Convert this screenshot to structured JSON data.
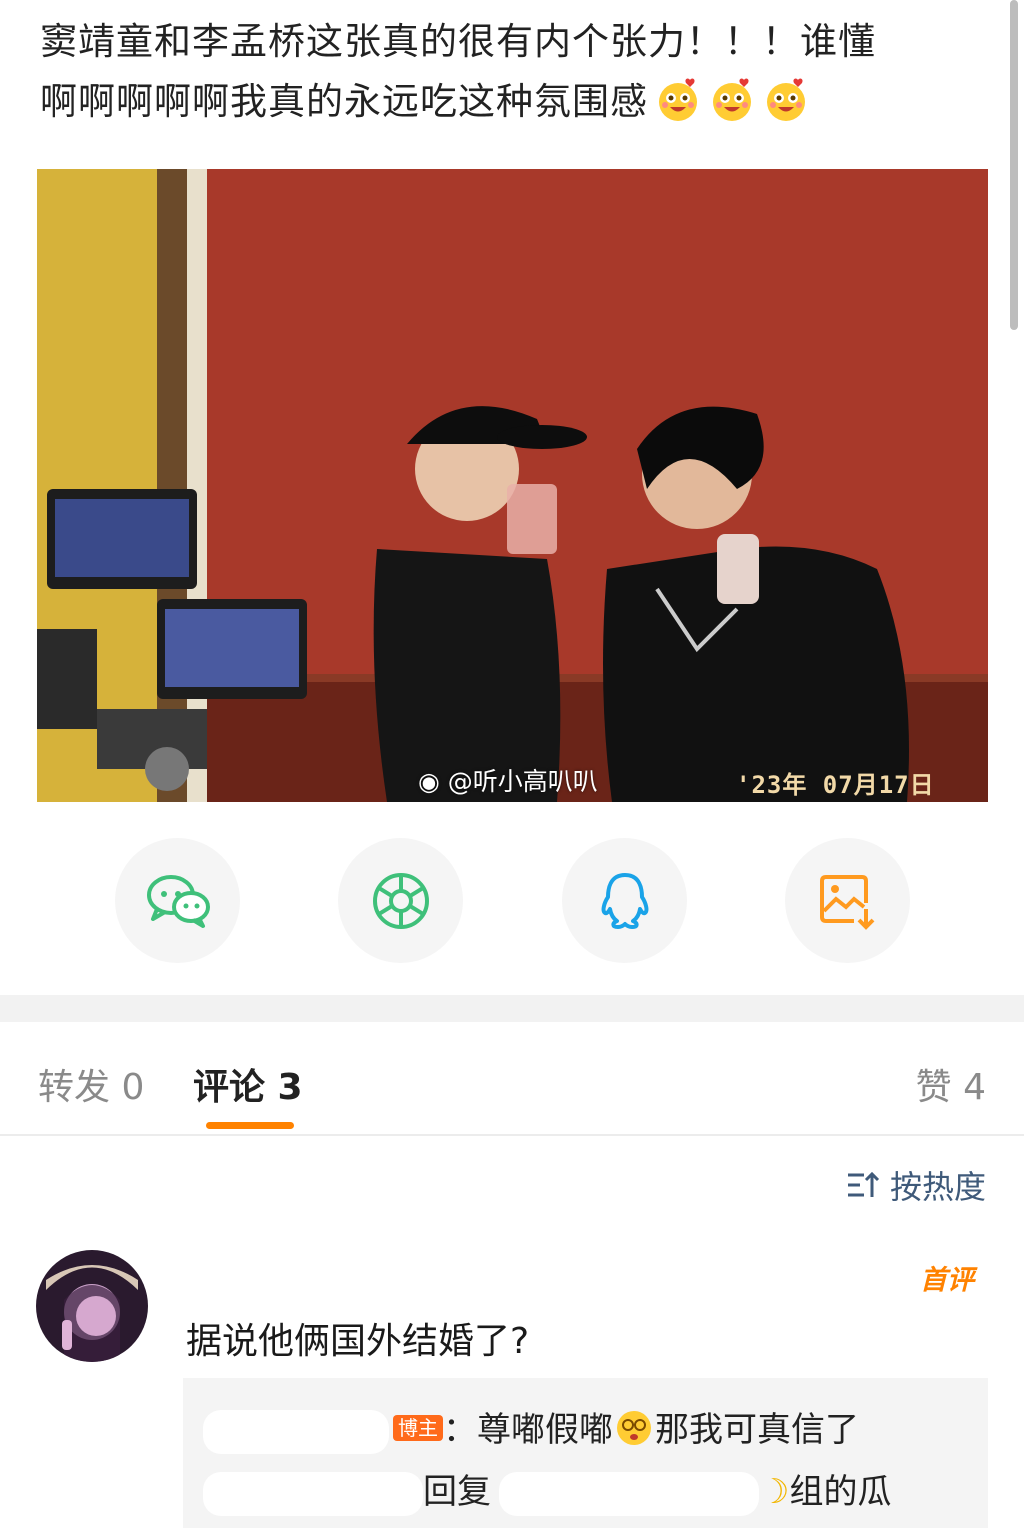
{
  "post": {
    "line1": "窦靖童和李孟桥这张真的很有内个张力！！！谁懂",
    "line2": "啊啊啊啊啊我真的永远吃这种氛围感",
    "emoji_count": 3,
    "emoji_icon": "heart-eyes-emoji"
  },
  "photo": {
    "watermark": "@听小高叭叭",
    "date_stamp": "'23年 07月17日"
  },
  "share": [
    {
      "name": "wechat",
      "icon": "wechat-icon",
      "color": "#3fc07a"
    },
    {
      "name": "moments",
      "icon": "moments-icon",
      "color": "#3fc07a"
    },
    {
      "name": "qq",
      "icon": "qq-icon",
      "color": "#1aa3e8"
    },
    {
      "name": "save-image",
      "icon": "save-image-icon",
      "color": "#ff9a1f"
    }
  ],
  "tabs": {
    "repost": "转发 0",
    "comments": "评论 3",
    "likes": "赞 4"
  },
  "sort": {
    "label": "按热度",
    "icon": "sort-icon"
  },
  "comment": {
    "first_badge": "首评",
    "text": "据说他俩国外结婚了?",
    "replies": {
      "host_badge": "博主",
      "reply1_text": "：尊嘟假嘟",
      "reply1_tail": "那我可真信了",
      "reply2_mid": "回复",
      "reply2_tail": "组的瓜"
    }
  },
  "colors": {
    "accent": "#ff8200",
    "link": "#3f5a7a"
  }
}
